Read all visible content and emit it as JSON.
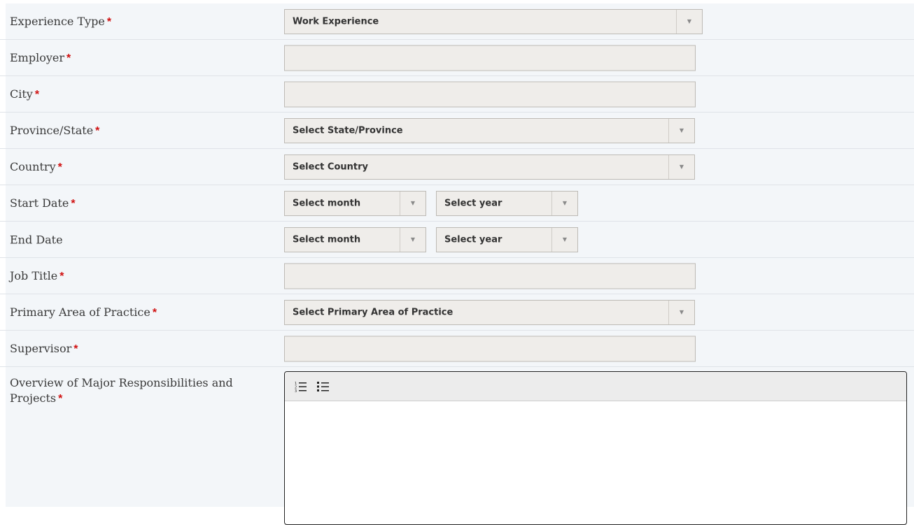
{
  "form": {
    "experience_type": {
      "label": "Experience Type",
      "required": "*",
      "value": "Work Experience"
    },
    "employer": {
      "label": "Employer",
      "required": "*",
      "value": ""
    },
    "city": {
      "label": "City",
      "required": "*",
      "value": ""
    },
    "province_state": {
      "label": "Province/State",
      "required": "*",
      "value": "Select State/Province"
    },
    "country": {
      "label": "Country",
      "required": "*",
      "value": "Select Country"
    },
    "start_date": {
      "label": "Start Date",
      "required": "*",
      "month": "Select month",
      "year": "Select year"
    },
    "end_date": {
      "label": "End Date",
      "month": "Select month",
      "year": "Select year"
    },
    "job_title": {
      "label": "Job Title",
      "required": "*",
      "value": ""
    },
    "primary_area": {
      "label": "Primary Area of Practice",
      "required": "*",
      "value": "Select Primary Area of Practice"
    },
    "supervisor": {
      "label": "Supervisor",
      "required": "*",
      "value": ""
    },
    "overview": {
      "label": "Overview of Major Responsibilities and Projects",
      "required": "*",
      "toolbar": {
        "ordered_list_icon": "ordered-list-icon",
        "unordered_list_icon": "unordered-list-icon"
      },
      "value": ""
    }
  },
  "colors": {
    "required": "#d01010",
    "row_background": "#f3f6f9",
    "input_background": "#efedea"
  }
}
